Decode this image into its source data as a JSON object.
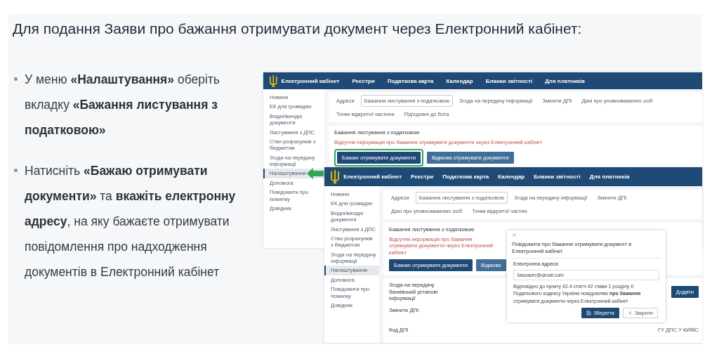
{
  "title": "Для подання Заяви про бажання отримувати документ через Електронний кабінет:",
  "bullets": [
    "У меню **«Налаштування»** оберіть вкладку **«Бажання листування з податковою»**",
    "Натисніть **«Бажаю отримувати документи»** та **вкажіть електронну адресу**, на яку бажаєте отримувати повідомлення про надходження документів в Електронний кабінет"
  ],
  "screenshots": [
    {
      "brand": "Електронний кабінет",
      "nav": [
        "Реєстри",
        "Податкова карта",
        "Календар",
        "Бланки звітності",
        "Для платників"
      ],
      "sidebar": [
        {
          "label": "Новини",
          "selected": false,
          "pointed": false
        },
        {
          "label": "ЕК для громадян",
          "selected": false,
          "pointed": false
        },
        {
          "label": "Вхідні/вихідні документи",
          "selected": false,
          "pointed": false
        },
        {
          "label": "Листування з ДПС",
          "selected": false,
          "pointed": false
        },
        {
          "label": "Стан розрахунків з бюджетом",
          "selected": false,
          "pointed": false
        },
        {
          "label": "Згоди на передачу інформації",
          "selected": false,
          "pointed": false
        },
        {
          "label": "Налаштування",
          "selected": true,
          "pointed": true
        },
        {
          "label": "Допомога",
          "selected": false,
          "pointed": false
        },
        {
          "label": "Повідомити про помилку",
          "selected": false,
          "pointed": false
        },
        {
          "label": "Довідник",
          "selected": false,
          "pointed": false
        }
      ],
      "tabs": [
        {
          "label": "Адреси",
          "selected": false
        },
        {
          "label": "Бажання листування з податковою",
          "selected": true
        },
        {
          "label": "Згода на передачу інформації",
          "selected": false
        },
        {
          "label": "Змінити ДПІ",
          "selected": false
        },
        {
          "label": "Дані про уповноважених осіб",
          "selected": false
        },
        {
          "label": "Точки відкритої частини",
          "selected": false
        },
        {
          "label": "Під'єднані до бота",
          "selected": false
        }
      ],
      "section_title": "Бажання листування з податковою",
      "notice": "Відсутня інформація про бажання отримувати документи через Електронний кабінет",
      "buttons": [
        {
          "label": "Бажаю отримувати документи",
          "kind": "primary",
          "highlighted": true
        },
        {
          "label": "Відмова отримувати документи",
          "kind": "secondary",
          "highlighted": false
        }
      ]
    },
    {
      "brand": "Електронний кабінет",
      "nav": [
        "Реєстри",
        "Податкова карта",
        "Календар",
        "Бланки звітності",
        "Для платників"
      ],
      "sidebar": [
        {
          "label": "Новини",
          "selected": false,
          "pointed": false
        },
        {
          "label": "ЕК для громадян",
          "selected": false,
          "pointed": false
        },
        {
          "label": "Вхідні/вихідні документи",
          "selected": false,
          "pointed": false
        },
        {
          "label": "Листування з ДПС",
          "selected": false,
          "pointed": false
        },
        {
          "label": "Стан розрахунків з бюджетом",
          "selected": false,
          "pointed": false
        },
        {
          "label": "Згоди на передачу інформації",
          "selected": false,
          "pointed": false
        },
        {
          "label": "Налаштування",
          "selected": true,
          "pointed": false
        },
        {
          "label": "Допомога",
          "selected": false,
          "pointed": false
        },
        {
          "label": "Повідомити про помилку",
          "selected": false,
          "pointed": false
        },
        {
          "label": "Довідник",
          "selected": false,
          "pointed": false
        }
      ],
      "tabs": [
        {
          "label": "Адреси",
          "selected": false
        },
        {
          "label": "Бажання листування з податковою",
          "selected": true
        },
        {
          "label": "Згода на передачу інформації",
          "selected": false
        },
        {
          "label": "Змінити ДПІ",
          "selected": false
        },
        {
          "label": "Дані про уповноважених осіб",
          "selected": false
        },
        {
          "label": "Точки відкритої частин",
          "selected": false
        }
      ],
      "section_title": "Бажання листування з податковою",
      "notice": "Відсутня інформація про бажання отримувати документи через Електронний кабінет",
      "buttons": [
        {
          "label": "Бажаю отримувати документи",
          "kind": "primary",
          "highlighted": false
        },
        {
          "label": "Відмова",
          "kind": "secondary",
          "highlighted": false
        }
      ],
      "settings": {
        "consent_title": "Згода на передачу банківській установі інформації",
        "add_button": "Додати",
        "change_label": "Змінити ДПІ:",
        "code_label": "Код ДПІ",
        "code_value": "ГУ ДПС У КИЇВС"
      },
      "dialog": {
        "title": "Повідомити про бажання отримувати документ в Електронний кабінет",
        "field_label": "Електронна адреса:",
        "email": "taxpayer@gmail.com",
        "note": "Відповідно до пункту 42.4 статті 42 глави 1 розділу II Податкового кодексу України повідомляю **про бажання** отримувати документи через Електронний кабінет",
        "save_button": "Зберегти",
        "close_button": "Закрити"
      }
    }
  ]
}
